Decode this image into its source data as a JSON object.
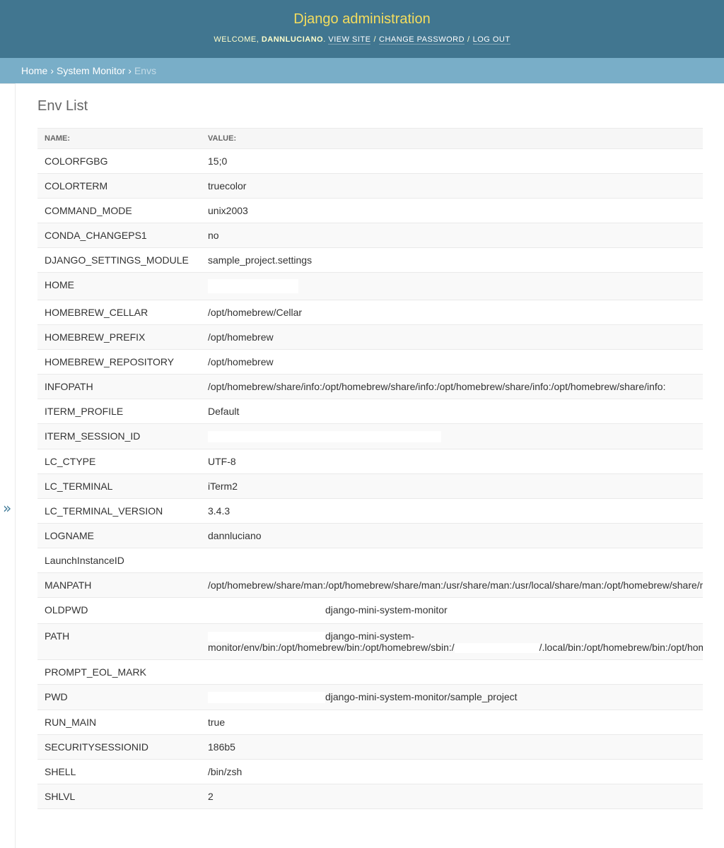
{
  "header": {
    "title": "Django administration",
    "welcome": "WELCOME,",
    "username": "DANNLUCIANO",
    "view_site": "VIEW SITE",
    "change_password": "CHANGE PASSWORD",
    "logout": "LOG OUT"
  },
  "breadcrumbs": {
    "home": "Home",
    "app": "System Monitor",
    "current": "Envs"
  },
  "page": {
    "title": "Env List"
  },
  "table": {
    "columns": [
      "NAME:",
      "VALUE:"
    ],
    "rows": [
      {
        "name": "COLORFGBG",
        "value": "15;0"
      },
      {
        "name": "COLORTERM",
        "value": "truecolor"
      },
      {
        "name": "COMMAND_MODE",
        "value": "unix2003"
      },
      {
        "name": "CONDA_CHANGEPS1",
        "value": "no"
      },
      {
        "name": "DJANGO_SETTINGS_MODULE",
        "value": "sample_project.settings"
      },
      {
        "name": "HOME",
        "value": ""
      },
      {
        "name": "HOMEBREW_CELLAR",
        "value": "/opt/homebrew/Cellar"
      },
      {
        "name": "HOMEBREW_PREFIX",
        "value": "/opt/homebrew"
      },
      {
        "name": "HOMEBREW_REPOSITORY",
        "value": "/opt/homebrew"
      },
      {
        "name": "INFOPATH",
        "value": "/opt/homebrew/share/info:/opt/homebrew/share/info:/opt/homebrew/share/info:/opt/homebrew/share/info:"
      },
      {
        "name": "ITERM_PROFILE",
        "value": "Default"
      },
      {
        "name": "ITERM_SESSION_ID",
        "value": ""
      },
      {
        "name": "LC_CTYPE",
        "value": "UTF-8"
      },
      {
        "name": "LC_TERMINAL",
        "value": "iTerm2"
      },
      {
        "name": "LC_TERMINAL_VERSION",
        "value": "3.4.3"
      },
      {
        "name": "LOGNAME",
        "value": "dannluciano"
      },
      {
        "name": "LaunchInstanceID",
        "value": ""
      },
      {
        "name": "MANPATH",
        "value": "/opt/homebrew/share/man:/opt/homebrew/share/man:/usr/share/man:/usr/local/share/man:/opt/homebrew/share/man:"
      },
      {
        "name": "OLDPWD",
        "value": "django-mini-system-monitor"
      },
      {
        "name": "PATH",
        "value_line1": "django-mini-system-",
        "value_line2a": "monitor/env/bin:/opt/homebrew/bin:/opt/homebrew/sbin:/",
        "value_line2b": "/.local/bin:/opt/homebrew/bin:/opt/homebrew/sbin:"
      },
      {
        "name": "PROMPT_EOL_MARK",
        "value": ""
      },
      {
        "name": "PWD",
        "value": "django-mini-system-monitor/sample_project"
      },
      {
        "name": "RUN_MAIN",
        "value": "true"
      },
      {
        "name": "SECURITYSESSIONID",
        "value": "186b5"
      },
      {
        "name": "SHELL",
        "value": "/bin/zsh"
      },
      {
        "name": "SHLVL",
        "value": "2"
      }
    ]
  },
  "sidebar": {
    "toggle_icon": "double-chevron-right-icon",
    "toggle_glyph": "»"
  },
  "colors": {
    "header_bg": "#417690",
    "branding": "#f5dd5d",
    "breadcrumbs_bg": "#79aec8",
    "link": "#447e9b"
  }
}
